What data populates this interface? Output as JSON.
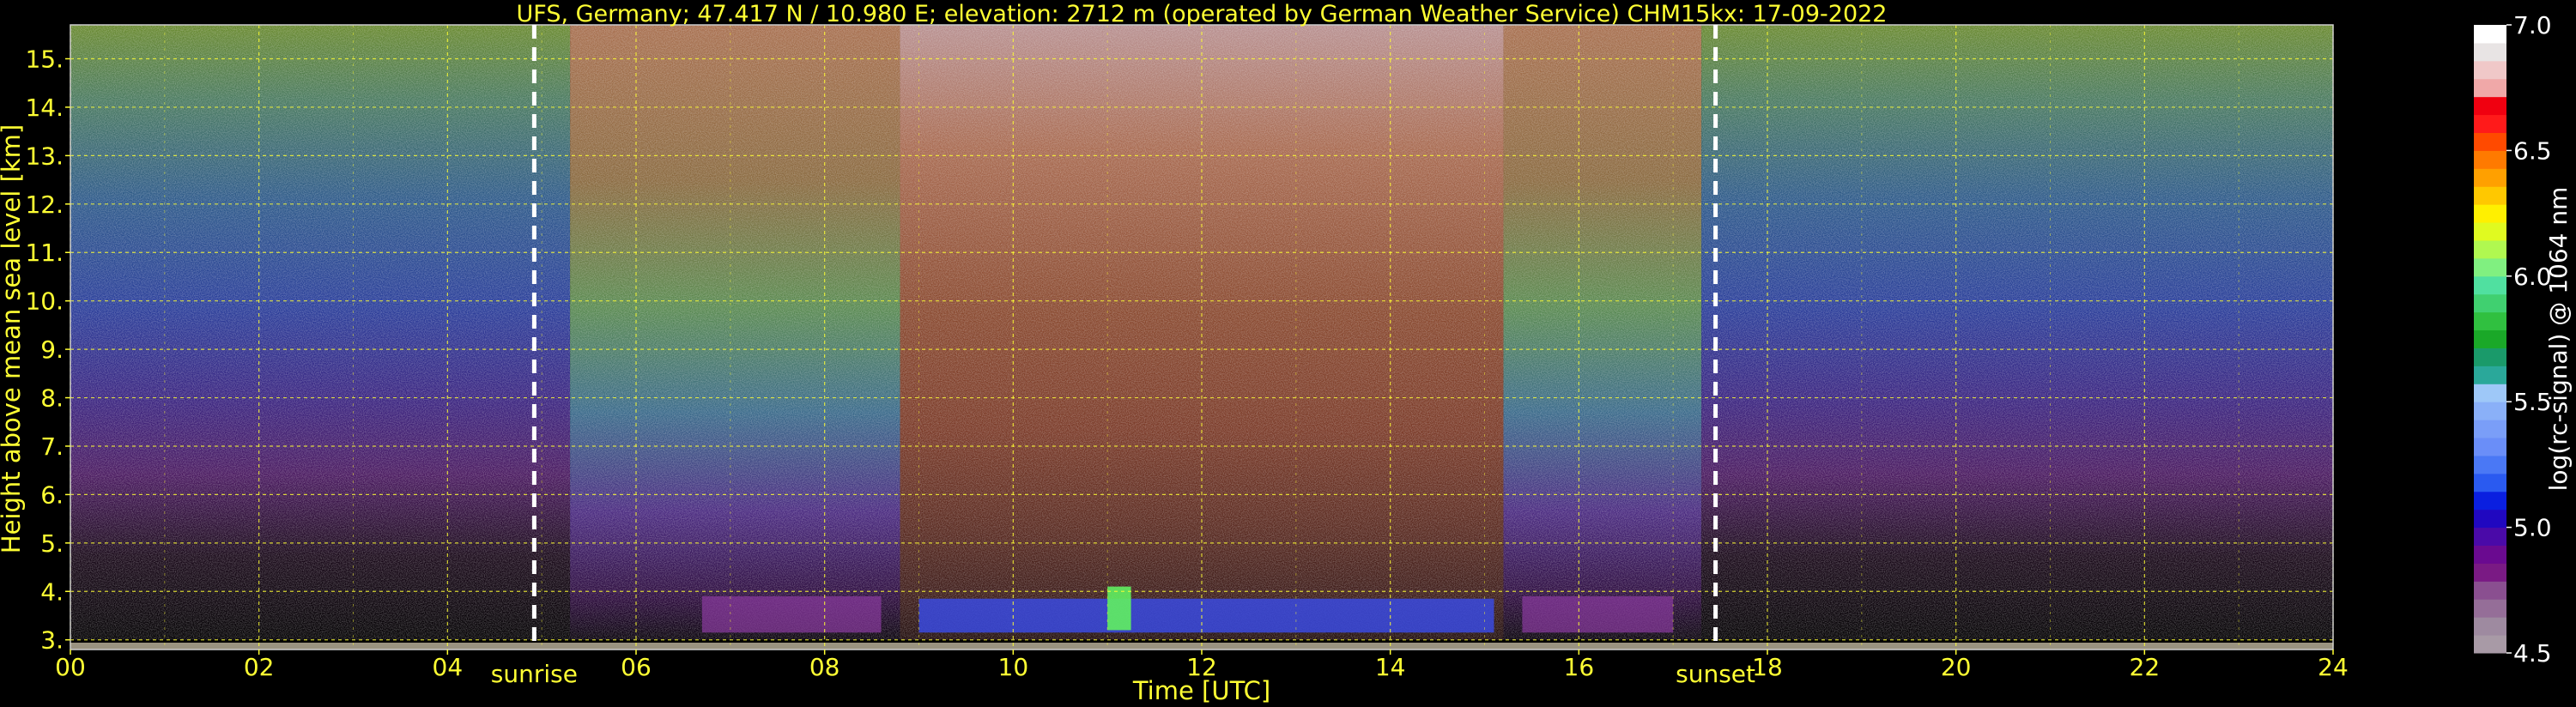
{
  "chart_data": {
    "type": "heatmap",
    "title": "UFS, Germany; 47.417 N / 10.980 E; elevation: 2712 m  (operated by German Weather Service)    CHM15kx: 17-09-2022",
    "xlabel": "Time [UTC]",
    "ylabel": "Height above mean sea level [km]",
    "xlim": [
      0,
      24
    ],
    "ylim": [
      2.8,
      15.7
    ],
    "x_ticks": [
      "00",
      "02",
      "04",
      "06",
      "08",
      "10",
      "12",
      "14",
      "16",
      "18",
      "20",
      "22",
      "24"
    ],
    "x_tick_values": [
      0,
      2,
      4,
      6,
      8,
      10,
      12,
      14,
      16,
      18,
      20,
      22,
      24
    ],
    "y_ticks": [
      "3.",
      "4.",
      "5.",
      "6.",
      "7.",
      "8.",
      "9.",
      "10.",
      "11.",
      "12.",
      "13.",
      "14.",
      "15."
    ],
    "y_tick_values": [
      3,
      4,
      5,
      6,
      7,
      8,
      9,
      10,
      11,
      12,
      13,
      14,
      15
    ],
    "grid": true,
    "annotations": [
      {
        "label": "sunrise",
        "x": 4.92
      },
      {
        "label": "sunset",
        "x": 17.45
      }
    ],
    "colorbar": {
      "label": "log(rc-signal) @ 1064 nm",
      "ticks": [
        "7.0",
        "6.5",
        "6.0",
        "5.5",
        "5.0",
        "4.5"
      ],
      "tick_values": [
        7.0,
        6.5,
        6.0,
        5.5,
        5.0,
        4.5
      ],
      "range": [
        4.5,
        7.0
      ],
      "colors": [
        "#a89aa6",
        "#9e8aa0",
        "#956e98",
        "#8a4f90",
        "#7a1a84",
        "#6a0a90",
        "#4a0aa8",
        "#2008c0",
        "#0a1fe0",
        "#2a5af0",
        "#4a78f5",
        "#6a8ef8",
        "#7a9ef8",
        "#8ab0f8",
        "#9ec8f8",
        "#2aa89a",
        "#1a9a6a",
        "#1aa828",
        "#30c040",
        "#40d070",
        "#50e0a0",
        "#80f080",
        "#b0f850",
        "#e0fa20",
        "#fff000",
        "#ffc800",
        "#ffa000",
        "#ff7a00",
        "#ff4a00",
        "#ff1a1a",
        "#f00010",
        "#f0a8a8",
        "#f0c8c8",
        "#e8e4e4",
        "#ffffff"
      ]
    },
    "sky_bands": [
      {
        "x0": 0,
        "x1": 5.3,
        "top": 15.7,
        "cmap": "night"
      },
      {
        "x0": 5.3,
        "x1": 8.8,
        "top": 15.7,
        "cmap": "mixed_day"
      },
      {
        "x0": 8.8,
        "x1": 15.2,
        "top": 15.7,
        "cmap": "day"
      },
      {
        "x0": 15.2,
        "x1": 17.3,
        "top": 15.7,
        "cmap": "mixed_day"
      },
      {
        "x0": 17.3,
        "x1": 24,
        "top": 15.7,
        "cmap": "night"
      }
    ]
  }
}
